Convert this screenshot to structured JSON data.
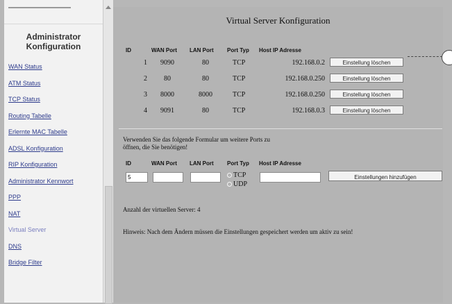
{
  "sidebar": {
    "title_line1": "Administrator",
    "title_line2": "Konfiguration",
    "items": [
      {
        "label": "WAN Status"
      },
      {
        "label": "ATM Status"
      },
      {
        "label": "TCP Status"
      },
      {
        "label": "Routing Tabelle"
      },
      {
        "label": "Erlernte MAC Tabelle"
      },
      {
        "label": "ADSL Konfiguration"
      },
      {
        "label": "RIP Konfiguration"
      },
      {
        "label": "Administrator Kennwort"
      },
      {
        "label": "PPP"
      },
      {
        "label": "NAT"
      },
      {
        "label": "Virtual Server",
        "active": true
      },
      {
        "label": "DNS"
      },
      {
        "label": "Bridge Filter"
      }
    ]
  },
  "main": {
    "title": "Virtual Server Konfiguration",
    "table_headers": {
      "id": "ID",
      "wan_port": "WAN Port",
      "lan_port": "LAN Port",
      "port_typ": "Port Typ",
      "host_ip": "Host IP Adresse"
    },
    "rows": [
      {
        "id": "1",
        "wan": "9090",
        "lan": "80",
        "typ": "TCP",
        "ip": "192.168.0.2",
        "action": "Einstellung löschen"
      },
      {
        "id": "2",
        "wan": "80",
        "lan": "80",
        "typ": "TCP",
        "ip": "192.168.0.250",
        "action": "Einstellung löschen"
      },
      {
        "id": "3",
        "wan": "8000",
        "lan": "8000",
        "typ": "TCP",
        "ip": "192.168.0.250",
        "action": "Einstellung löschen"
      },
      {
        "id": "4",
        "wan": "9091",
        "lan": "80",
        "typ": "TCP",
        "ip": "192.168.0.3",
        "action": "Einstellung löschen"
      }
    ],
    "form": {
      "intro_line1": "Verwenden Sie das folgende Formular um weitere Ports zu",
      "intro_line2": "öffnen, die Sie benötigen!",
      "headers": {
        "id": "ID",
        "wan_port": "WAN Port",
        "lan_port": "LAN Port",
        "port_typ": "Port Typ",
        "host_ip": "Host IP Adresse"
      },
      "id_value": "5",
      "wan_value": "",
      "lan_value": "",
      "ip_value": "",
      "radio_tcp": "TCP",
      "radio_udp": "UDP",
      "add_button": "Einstellungen hinzufügen"
    },
    "server_count": "Anzahl der virtuellen Server: 4",
    "hint": "Hinweis: Nach dem Ändern müssen die Einstellungen gespeichert werden um aktiv zu sein!"
  }
}
